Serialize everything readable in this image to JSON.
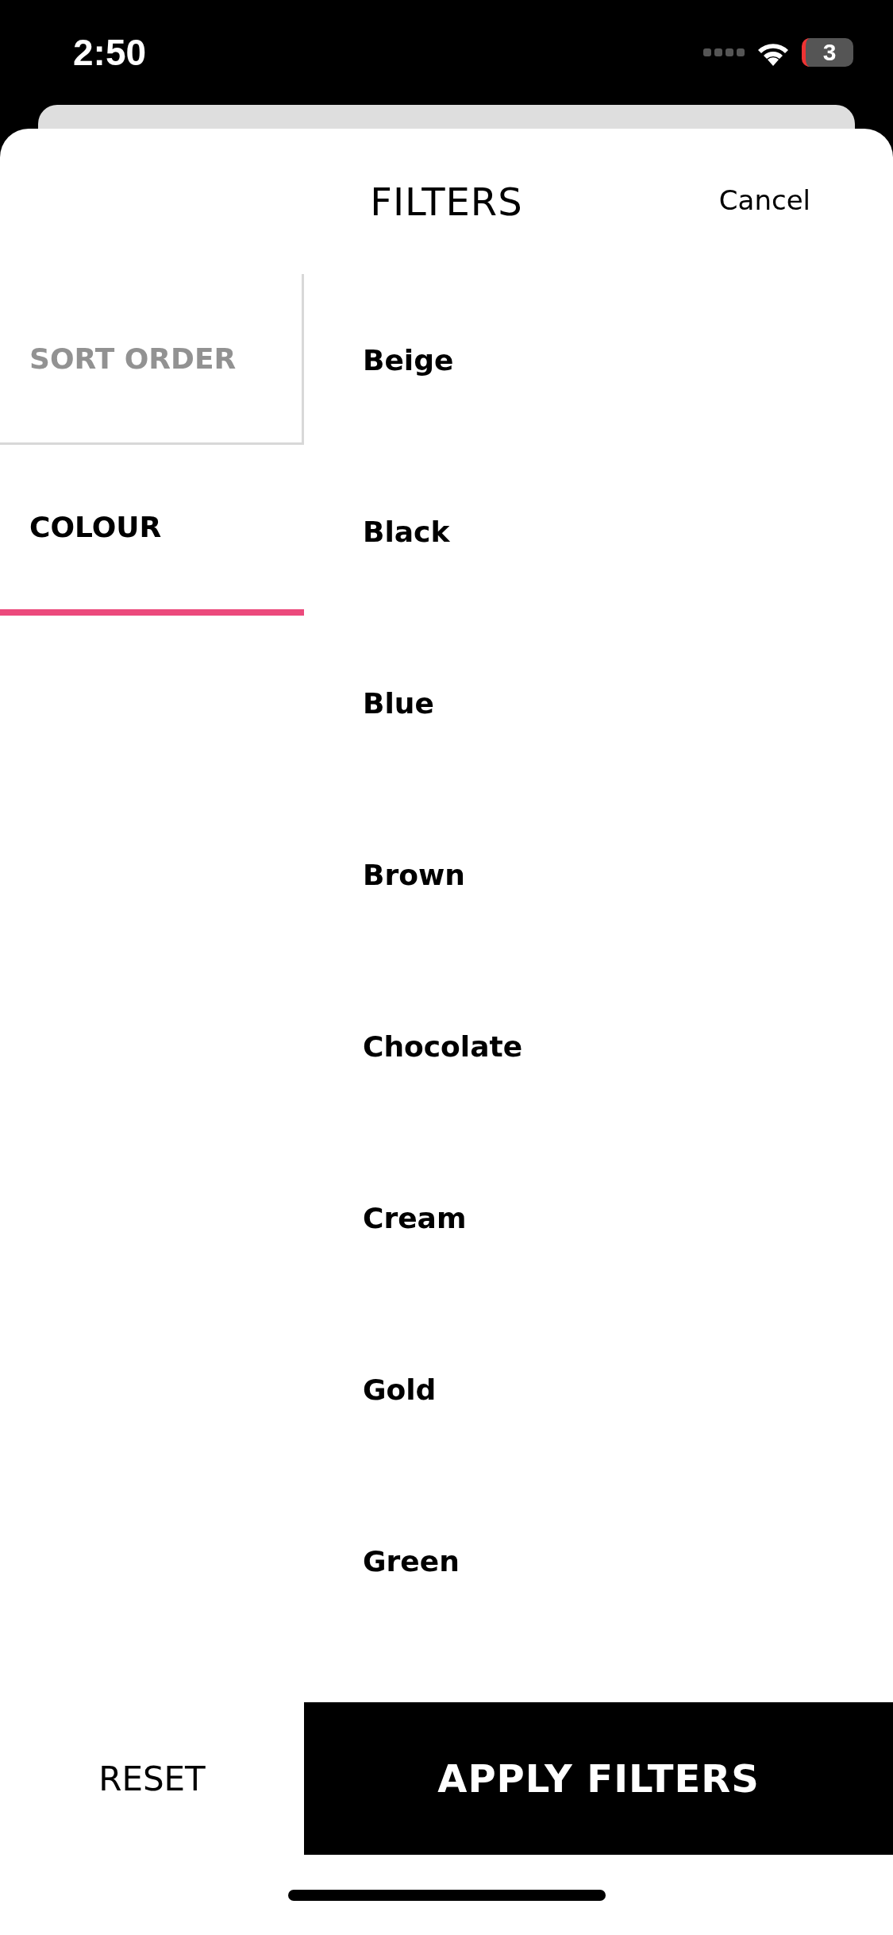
{
  "status_bar": {
    "time": "2:50",
    "battery": "3"
  },
  "header": {
    "title": "FILTERS",
    "cancel": "Cancel"
  },
  "tabs": [
    {
      "label": "SORT ORDER",
      "selected": false
    },
    {
      "label": "COLOUR",
      "selected": true
    }
  ],
  "options": [
    {
      "label": "Beige"
    },
    {
      "label": "Black"
    },
    {
      "label": "Blue"
    },
    {
      "label": "Brown"
    },
    {
      "label": "Chocolate"
    },
    {
      "label": "Cream"
    },
    {
      "label": "Gold"
    },
    {
      "label": "Green"
    }
  ],
  "footer": {
    "reset": "RESET",
    "apply": "APPLY FILTERS"
  }
}
